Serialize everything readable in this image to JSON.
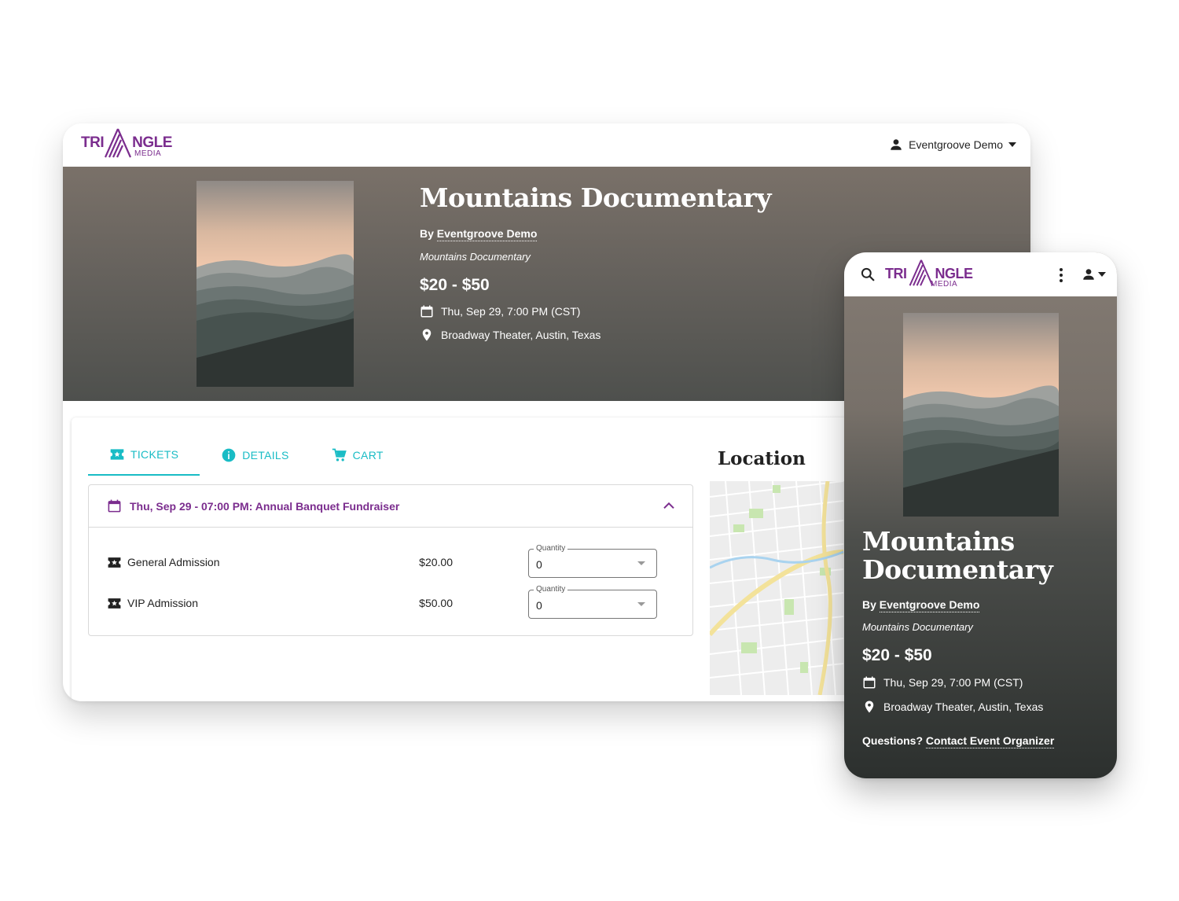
{
  "brand": {
    "word_left": "TRI",
    "word_right": "NGLE",
    "sub": "MEDIA",
    "color": "#7b2d8e"
  },
  "header": {
    "user_name": "Eventgroove Demo"
  },
  "event": {
    "title": "Mountains Documentary",
    "by_prefix": "By ",
    "organizer": "Eventgroove Demo",
    "subtitle": "Mountains Documentary",
    "price_range": "$20 - $50",
    "datetime": "Thu, Sep 29, 7:00 PM (CST)",
    "venue": "Broadway Theater, Austin, Texas"
  },
  "tabs": [
    {
      "label": "TICKETS",
      "icon": "ticket-star-icon",
      "active": true
    },
    {
      "label": "DETAILS",
      "icon": "info-icon",
      "active": false
    },
    {
      "label": "CART",
      "icon": "cart-icon",
      "active": false
    }
  ],
  "accent_color": "#19bcc5",
  "session": {
    "title": "Thu, Sep 29 - 07:00 PM: Annual Banquet Fundraiser",
    "tickets": [
      {
        "name": "General Admission",
        "price": "$20.00",
        "qty_label": "Quantity",
        "qty": "0"
      },
      {
        "name": "VIP Admission",
        "price": "$50.00",
        "qty_label": "Quantity",
        "qty": "0"
      }
    ]
  },
  "location": {
    "title": "Location"
  },
  "mobile": {
    "questions": "Questions? ",
    "contact": "Contact Event Organizer"
  }
}
